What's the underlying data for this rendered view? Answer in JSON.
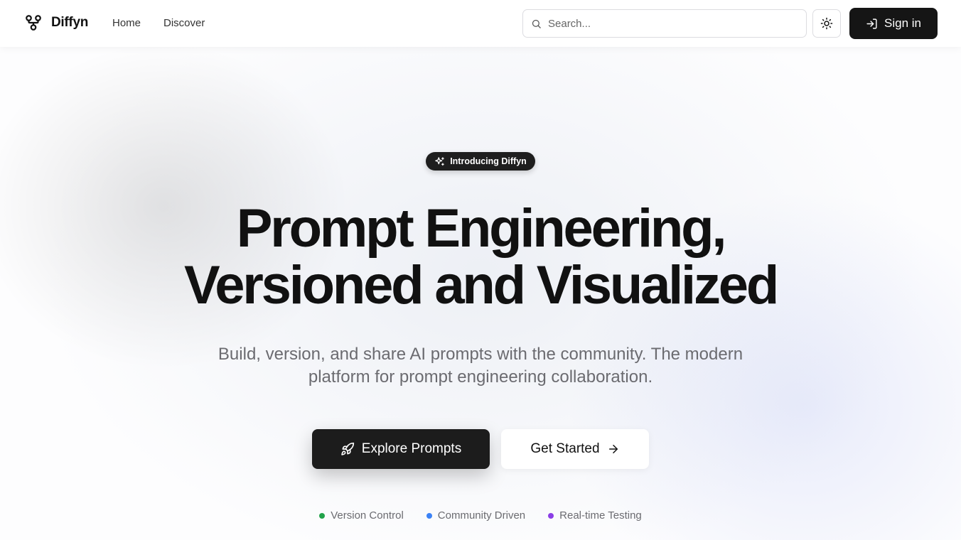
{
  "header": {
    "logo_icon": "git-fork-icon",
    "brand": "Diffyn",
    "nav": [
      {
        "label": "Home"
      },
      {
        "label": "Discover"
      }
    ],
    "search": {
      "placeholder": "Search...",
      "icon": "search-icon"
    },
    "theme_toggle_icon": "sun-icon",
    "signin": {
      "label": "Sign in",
      "icon": "log-in-icon"
    }
  },
  "hero": {
    "badge": {
      "label": "Introducing Diffyn",
      "icon": "sparkles-icon"
    },
    "headline": [
      "Prompt Engineering,",
      "Versioned and Visualized"
    ],
    "subtitle": "Build, version, and share AI prompts with the community. The modern platform for prompt engineering collaboration.",
    "primary_cta": {
      "label": "Explore Prompts",
      "icon": "rocket-icon"
    },
    "secondary_cta": {
      "label": "Get Started",
      "icon": "arrow-right-icon"
    },
    "features": [
      {
        "label": "Version Control",
        "color": "#22a34a"
      },
      {
        "label": "Community Driven",
        "color": "#3b82f6"
      },
      {
        "label": "Real-time Testing",
        "color": "#8b3ee6"
      }
    ]
  },
  "colors": {
    "primary": "#151515",
    "text": "#111111",
    "muted": "#6b6b70",
    "background": "#ffffff"
  }
}
